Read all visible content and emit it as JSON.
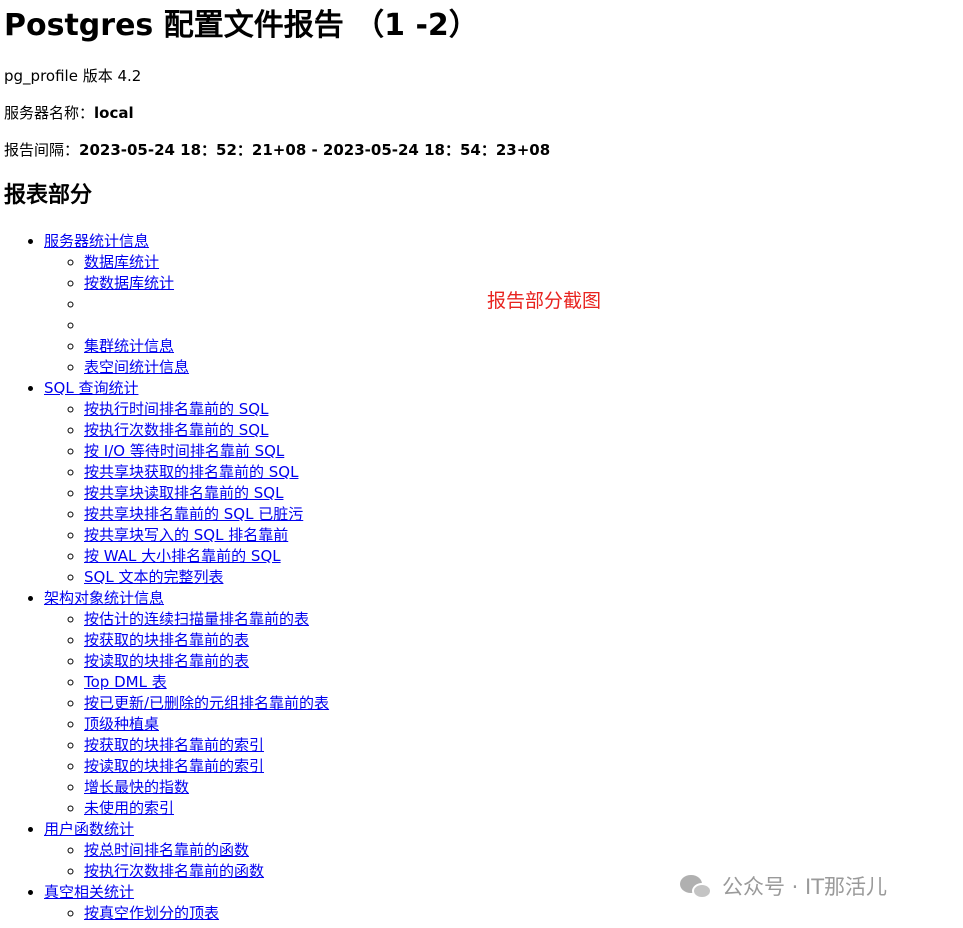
{
  "header": {
    "title": "Postgres 配置文件报告 （1 -2）",
    "version_text": "pg_profile 版本 4.2",
    "server_label": "服务器名称：",
    "server_value": "local",
    "interval_label": "报告间隔：",
    "interval_value": "2023-05-24 18：52：21+08 - 2023-05-24 18：54：23+08"
  },
  "section": {
    "title": "报表部分"
  },
  "annotation": {
    "text": "报告部分截图"
  },
  "toc": {
    "server_stats": {
      "label": "服务器统计信息",
      "items": [
        "数据库统计",
        "按数据库统计",
        "",
        "",
        "集群统计信息",
        "表空间统计信息"
      ]
    },
    "sql_stats": {
      "label": "SQL 查询统计",
      "items": [
        "按执行时间排名靠前的 SQL",
        "按执行次数排名靠前的 SQL",
        "按 I/O 等待时间排名靠前 SQL",
        "按共享块获取的排名靠前的 SQL",
        "按共享块读取排名靠前的 SQL",
        "按共享块排名靠前的 SQL 已脏污",
        "按共享块写入的 SQL 排名靠前",
        "按 WAL 大小排名靠前的 SQL",
        "SQL 文本的完整列表"
      ]
    },
    "schema_stats": {
      "label": "架构对象统计信息",
      "items": [
        "按估计的连续扫描量排名靠前的表",
        "按获取的块排名靠前的表",
        "按读取的块排名靠前的表",
        "Top DML 表",
        "按已更新/已删除的元组排名靠前的表",
        "顶级种植桌",
        "按获取的块排名靠前的索引",
        "按读取的块排名靠前的索引",
        "增长最快的指数",
        "未使用的索引"
      ]
    },
    "function_stats": {
      "label": "用户函数统计",
      "items": [
        "按总时间排名靠前的函数",
        "按执行次数排名靠前的函数"
      ]
    },
    "vacuum_stats": {
      "label": "真空相关统计",
      "items": [
        "按真空作划分的顶表"
      ]
    }
  },
  "watermark": {
    "icon": "wechat-icon",
    "text": "公众号 · IT那活儿"
  }
}
